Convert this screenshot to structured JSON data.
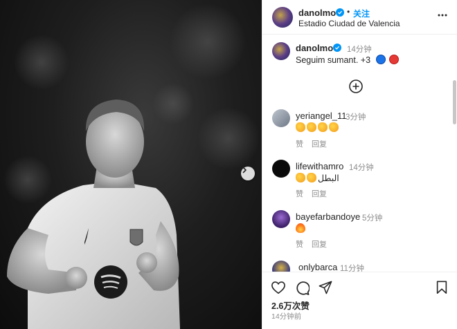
{
  "post": {
    "author": "danolmo",
    "follow_label": "关注",
    "location": "Estadio Ciudad de Valencia",
    "caption": "Seguim sumant. +3",
    "time_ago": "14分钟",
    "likes": "2.6万次赞",
    "posted": "14分钟前"
  },
  "comments": [
    {
      "user": "yeriangel_11",
      "time": "3分钟",
      "text": "",
      "emoji_count": 4,
      "emoji_kind": "clap",
      "like_label": "赞",
      "reply_label": "回复"
    },
    {
      "user": "lifewithamro",
      "time": "14分钟",
      "text": "البطل",
      "emoji_count": 2,
      "emoji_kind": "clap",
      "like_label": "赞",
      "reply_label": "回复"
    },
    {
      "user": "bayefarbandoye",
      "time": "5分钟",
      "text": "",
      "emoji_count": 1,
      "emoji_kind": "flame",
      "like_label": "赞",
      "reply_label": "回复"
    },
    {
      "user": "onlybarca",
      "time": "11分钟"
    }
  ],
  "icons": [
    "more-options-icon",
    "verified-icon",
    "add-circle-icon",
    "heart-icon",
    "comment-icon",
    "share-icon",
    "bookmark-icon",
    "chevron-right-icon"
  ],
  "colors": {
    "accent": "#0095f6",
    "text": "#262626",
    "muted": "#8e8e8e"
  }
}
